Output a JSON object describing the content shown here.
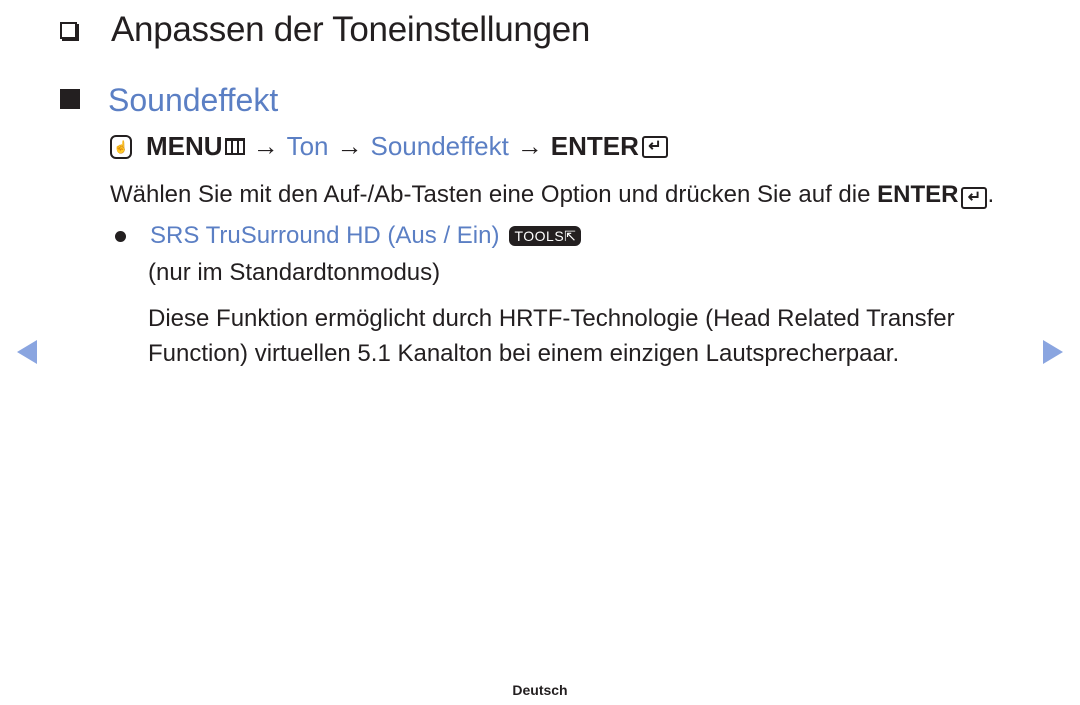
{
  "title": "Anpassen der Toneinstellungen",
  "section": {
    "title": "Soundeffekt"
  },
  "path": {
    "menu_label": "MENU",
    "step1": "Ton",
    "step2": "Soundeffekt",
    "enter_label": "ENTER",
    "arrow": "→"
  },
  "instruction": {
    "text": "Wählen Sie mit den Auf-/Ab-Tasten eine Option und drücken Sie auf die ",
    "enter_label": "ENTER",
    "end": "."
  },
  "option": {
    "label": "SRS TruSurround HD (Aus / Ein)",
    "tools_badge": "TOOLS",
    "note": "(nur im Standardtonmodus)",
    "description_line1": "Diese Funktion ermöglicht durch HRTF-Technologie (Head Related Transfer",
    "description_line2": "Function) virtuellen 5.1 Kanalton bei einem einzigen Lautsprecherpaar."
  },
  "icons": {
    "enter_glyph": "↵",
    "tools_glyph": "⇱"
  },
  "colors": {
    "accent": "#5b7fc4",
    "nav_arrow": "#8aa5e0",
    "text": "#231f20"
  },
  "footer": {
    "language": "Deutsch"
  }
}
